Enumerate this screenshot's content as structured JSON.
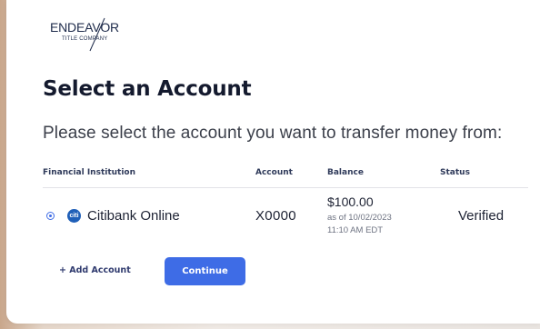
{
  "brand": {
    "logo_main": "ENDEAVOR",
    "logo_sub": "TITLE COMPANY"
  },
  "page": {
    "title": "Select an Account",
    "subtitle": "Please select the account you want to transfer money from:"
  },
  "table": {
    "columns": [
      "Financial Institution",
      "Account",
      "Balance",
      "Status"
    ],
    "rows": [
      {
        "selected": true,
        "icon_text": "citi",
        "institution": "Citibank Online",
        "account": "X0000",
        "balance": "$100.00",
        "balance_as_of": "as of 10/02/2023",
        "balance_time": "11:10 AM EDT",
        "status": "Verified"
      }
    ]
  },
  "actions": {
    "add_account": "+ Add Account",
    "continue": "Continue"
  },
  "colors": {
    "accent": "#3e6ce6",
    "heading": "#141a2e",
    "citi_blue": "#1f5fb8"
  }
}
